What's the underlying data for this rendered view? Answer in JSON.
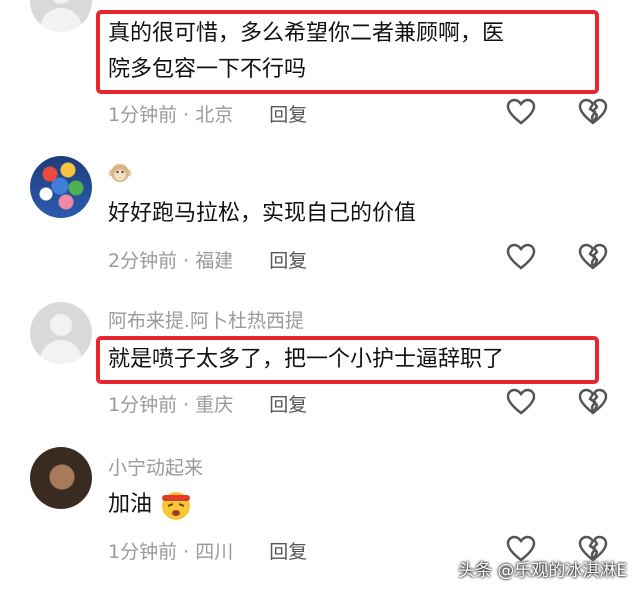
{
  "comments": [
    {
      "username": "",
      "text_line1": "真的很可惜，多么希望你二者兼顾啊，医",
      "text_line2": "院多包容一下不行吗",
      "time": "1分钟前 · 北京",
      "reply": "回复",
      "highlighted": true
    },
    {
      "username_icon": "monkey-face-icon",
      "text": "好好跑马拉松，实现自己的价值",
      "time": "2分钟前 · 福建",
      "reply": "回复",
      "highlighted": false
    },
    {
      "username": "阿布来提.阿卜杜热西提",
      "text": "就是喷子太多了，把一个小护士逼辞职了",
      "time": "1分钟前 · 重庆",
      "reply": "回复",
      "highlighted": true
    },
    {
      "username": "小宁动起来",
      "text": "加油",
      "text_emoji": "fighting-face-emoji",
      "time": "1分钟前 · 四川",
      "reply": "回复",
      "highlighted": false
    }
  ],
  "watermark": "头条 @乐观的冰淇淋E",
  "colors": {
    "highlight": "#e8262b",
    "meta": "#9a9a9a",
    "text": "#111111"
  }
}
